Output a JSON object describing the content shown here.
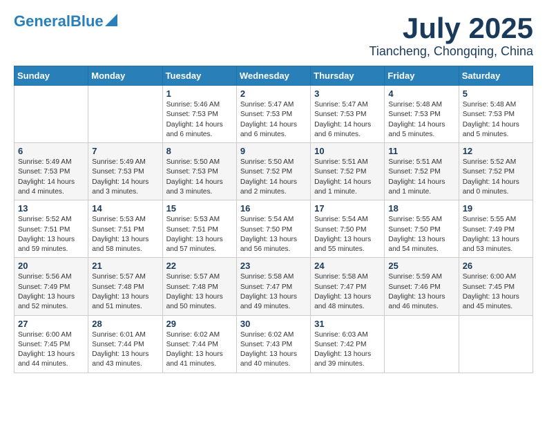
{
  "header": {
    "logo_line1": "General",
    "logo_line2": "Blue",
    "month": "July 2025",
    "location": "Tiancheng, Chongqing, China"
  },
  "weekdays": [
    "Sunday",
    "Monday",
    "Tuesday",
    "Wednesday",
    "Thursday",
    "Friday",
    "Saturday"
  ],
  "weeks": [
    [
      {
        "day": "",
        "content": ""
      },
      {
        "day": "",
        "content": ""
      },
      {
        "day": "1",
        "content": "Sunrise: 5:46 AM\nSunset: 7:53 PM\nDaylight: 14 hours and 6 minutes."
      },
      {
        "day": "2",
        "content": "Sunrise: 5:47 AM\nSunset: 7:53 PM\nDaylight: 14 hours and 6 minutes."
      },
      {
        "day": "3",
        "content": "Sunrise: 5:47 AM\nSunset: 7:53 PM\nDaylight: 14 hours and 6 minutes."
      },
      {
        "day": "4",
        "content": "Sunrise: 5:48 AM\nSunset: 7:53 PM\nDaylight: 14 hours and 5 minutes."
      },
      {
        "day": "5",
        "content": "Sunrise: 5:48 AM\nSunset: 7:53 PM\nDaylight: 14 hours and 5 minutes."
      }
    ],
    [
      {
        "day": "6",
        "content": "Sunrise: 5:49 AM\nSunset: 7:53 PM\nDaylight: 14 hours and 4 minutes."
      },
      {
        "day": "7",
        "content": "Sunrise: 5:49 AM\nSunset: 7:53 PM\nDaylight: 14 hours and 3 minutes."
      },
      {
        "day": "8",
        "content": "Sunrise: 5:50 AM\nSunset: 7:53 PM\nDaylight: 14 hours and 3 minutes."
      },
      {
        "day": "9",
        "content": "Sunrise: 5:50 AM\nSunset: 7:52 PM\nDaylight: 14 hours and 2 minutes."
      },
      {
        "day": "10",
        "content": "Sunrise: 5:51 AM\nSunset: 7:52 PM\nDaylight: 14 hours and 1 minute."
      },
      {
        "day": "11",
        "content": "Sunrise: 5:51 AM\nSunset: 7:52 PM\nDaylight: 14 hours and 1 minute."
      },
      {
        "day": "12",
        "content": "Sunrise: 5:52 AM\nSunset: 7:52 PM\nDaylight: 14 hours and 0 minutes."
      }
    ],
    [
      {
        "day": "13",
        "content": "Sunrise: 5:52 AM\nSunset: 7:51 PM\nDaylight: 13 hours and 59 minutes."
      },
      {
        "day": "14",
        "content": "Sunrise: 5:53 AM\nSunset: 7:51 PM\nDaylight: 13 hours and 58 minutes."
      },
      {
        "day": "15",
        "content": "Sunrise: 5:53 AM\nSunset: 7:51 PM\nDaylight: 13 hours and 57 minutes."
      },
      {
        "day": "16",
        "content": "Sunrise: 5:54 AM\nSunset: 7:50 PM\nDaylight: 13 hours and 56 minutes."
      },
      {
        "day": "17",
        "content": "Sunrise: 5:54 AM\nSunset: 7:50 PM\nDaylight: 13 hours and 55 minutes."
      },
      {
        "day": "18",
        "content": "Sunrise: 5:55 AM\nSunset: 7:50 PM\nDaylight: 13 hours and 54 minutes."
      },
      {
        "day": "19",
        "content": "Sunrise: 5:55 AM\nSunset: 7:49 PM\nDaylight: 13 hours and 53 minutes."
      }
    ],
    [
      {
        "day": "20",
        "content": "Sunrise: 5:56 AM\nSunset: 7:49 PM\nDaylight: 13 hours and 52 minutes."
      },
      {
        "day": "21",
        "content": "Sunrise: 5:57 AM\nSunset: 7:48 PM\nDaylight: 13 hours and 51 minutes."
      },
      {
        "day": "22",
        "content": "Sunrise: 5:57 AM\nSunset: 7:48 PM\nDaylight: 13 hours and 50 minutes."
      },
      {
        "day": "23",
        "content": "Sunrise: 5:58 AM\nSunset: 7:47 PM\nDaylight: 13 hours and 49 minutes."
      },
      {
        "day": "24",
        "content": "Sunrise: 5:58 AM\nSunset: 7:47 PM\nDaylight: 13 hours and 48 minutes."
      },
      {
        "day": "25",
        "content": "Sunrise: 5:59 AM\nSunset: 7:46 PM\nDaylight: 13 hours and 46 minutes."
      },
      {
        "day": "26",
        "content": "Sunrise: 6:00 AM\nSunset: 7:45 PM\nDaylight: 13 hours and 45 minutes."
      }
    ],
    [
      {
        "day": "27",
        "content": "Sunrise: 6:00 AM\nSunset: 7:45 PM\nDaylight: 13 hours and 44 minutes."
      },
      {
        "day": "28",
        "content": "Sunrise: 6:01 AM\nSunset: 7:44 PM\nDaylight: 13 hours and 43 minutes."
      },
      {
        "day": "29",
        "content": "Sunrise: 6:02 AM\nSunset: 7:44 PM\nDaylight: 13 hours and 41 minutes."
      },
      {
        "day": "30",
        "content": "Sunrise: 6:02 AM\nSunset: 7:43 PM\nDaylight: 13 hours and 40 minutes."
      },
      {
        "day": "31",
        "content": "Sunrise: 6:03 AM\nSunset: 7:42 PM\nDaylight: 13 hours and 39 minutes."
      },
      {
        "day": "",
        "content": ""
      },
      {
        "day": "",
        "content": ""
      }
    ]
  ]
}
